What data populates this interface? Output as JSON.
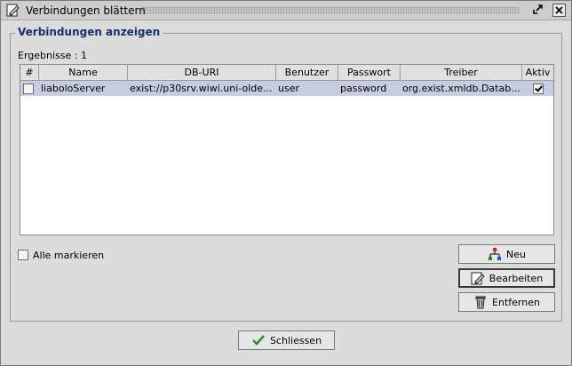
{
  "window": {
    "title": "Verbindungen blättern"
  },
  "group": {
    "title": "Verbindungen anzeigen"
  },
  "results": {
    "label": "Ergebnisse : 1"
  },
  "table": {
    "columns": [
      "#",
      "Name",
      "DB-URI",
      "Benutzer",
      "Passwort",
      "Treiber",
      "Aktiv"
    ],
    "rows": [
      {
        "selected": false,
        "name": "liaboloServer",
        "db_uri": "exist://p30srv.wiwi.uni-olde...",
        "user": "user",
        "password": "password",
        "driver": "org.exist.xmldb.Datab...",
        "active": true
      }
    ]
  },
  "mark_all": {
    "label": "Alle markieren",
    "checked": false
  },
  "buttons": {
    "new": "Neu",
    "edit": "Bearbeiten",
    "remove": "Entfernen",
    "close": "Schliessen"
  }
}
